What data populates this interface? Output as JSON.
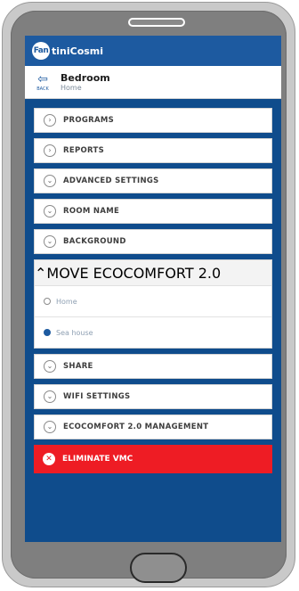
{
  "app": {
    "logo_mark": "Fan",
    "logo_text": "tiniCosmi"
  },
  "header": {
    "back_icon": "back-arrow-icon",
    "back_label": "BACK",
    "title": "Bedroom",
    "subtitle": "Home"
  },
  "menu": {
    "programs": "PROGRAMS",
    "reports": "REPORTS",
    "advanced": "ADVANCED SETTINGS",
    "room_name": "ROOM NAME",
    "background": "BACKGROUND",
    "move": "MOVE ECOCOMFORT 2.0",
    "options": [
      {
        "label": "Home",
        "selected": false
      },
      {
        "label": "Sea house",
        "selected": true
      }
    ],
    "share": "SHARE",
    "wifi": "WIFI SETTINGS",
    "management": "ECOCOMFORT 2.0 MANAGEMENT",
    "eliminate": "ELIMINATE VMC"
  },
  "colors": {
    "primary": "#1d5aa0",
    "background": "#0f4c8c",
    "danger": "#ee1c24"
  }
}
